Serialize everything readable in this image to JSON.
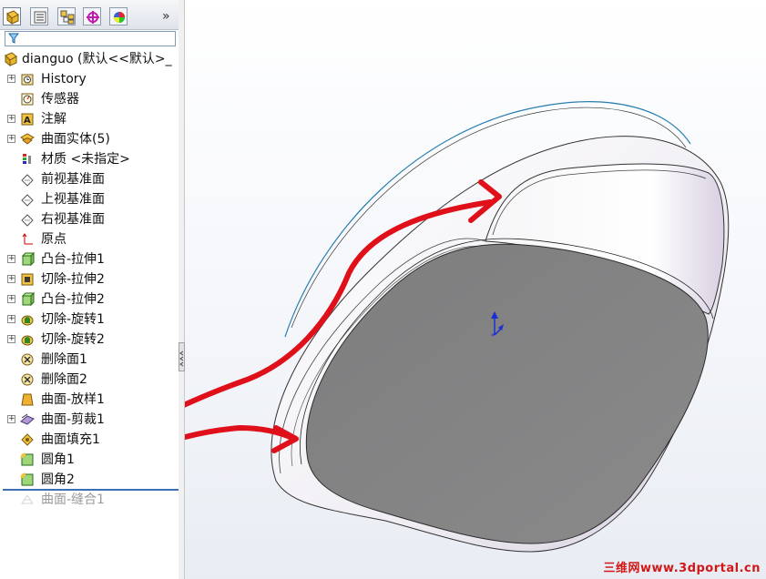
{
  "feature_tree": {
    "root": {
      "label": "dianguo  (默认<<默认>_"
    },
    "items": [
      {
        "label": "History",
        "icon": "history-icon",
        "expandable": true
      },
      {
        "label": "传感器",
        "icon": "sensor-icon",
        "expandable": false
      },
      {
        "label": "注解",
        "icon": "annotation-icon",
        "expandable": true
      },
      {
        "label": "曲面实体(5)",
        "icon": "surface-bodies-icon",
        "expandable": true
      },
      {
        "label": "材质 <未指定>",
        "icon": "material-icon",
        "expandable": false
      },
      {
        "label": "前视基准面",
        "icon": "plane-icon",
        "expandable": false
      },
      {
        "label": "上视基准面",
        "icon": "plane-icon",
        "expandable": false
      },
      {
        "label": "右视基准面",
        "icon": "plane-icon",
        "expandable": false
      },
      {
        "label": "原点",
        "icon": "origin-icon",
        "expandable": false
      },
      {
        "label": "凸台-拉伸1",
        "icon": "boss-extrude-icon",
        "expandable": true
      },
      {
        "label": "切除-拉伸2",
        "icon": "cut-extrude-icon",
        "expandable": true
      },
      {
        "label": "凸台-拉伸2",
        "icon": "boss-extrude-icon",
        "expandable": true
      },
      {
        "label": "切除-旋转1",
        "icon": "cut-revolve-icon",
        "expandable": true
      },
      {
        "label": "切除-旋转2",
        "icon": "cut-revolve-icon",
        "expandable": true
      },
      {
        "label": "删除面1",
        "icon": "delete-face-icon",
        "expandable": false
      },
      {
        "label": "删除面2",
        "icon": "delete-face-icon",
        "expandable": false
      },
      {
        "label": "曲面-放样1",
        "icon": "surface-loft-icon",
        "expandable": false
      },
      {
        "label": "曲面-剪裁1",
        "icon": "surface-trim-icon",
        "expandable": true
      },
      {
        "label": "曲面填充1",
        "icon": "surface-fill-icon",
        "expandable": false
      },
      {
        "label": "圆角1",
        "icon": "fillet-icon",
        "expandable": false
      },
      {
        "label": "圆角2",
        "icon": "fillet-icon",
        "expandable": false
      },
      {
        "label": "曲面-缝合1",
        "icon": "surface-knit-icon",
        "expandable": false,
        "suppressed": true
      }
    ]
  },
  "tabs": [
    "featuremanager-tab",
    "propertymanager-tab",
    "configurationmanager-tab",
    "dimxpert-tab",
    "display-manager-tab"
  ],
  "watermark": {
    "text": "三维网www.3dportal.cn"
  },
  "colors": {
    "annotation": "#e0101a",
    "model_face": "#838384",
    "edge_blue": "#2a7fb0",
    "triad_blue": "#1a2fd0"
  }
}
